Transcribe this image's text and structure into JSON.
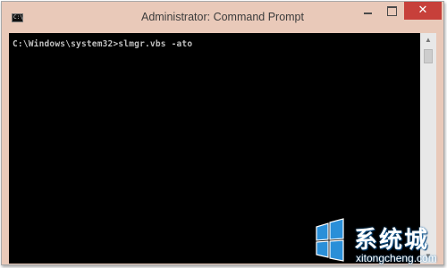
{
  "window": {
    "title": "Administrator: Command Prompt",
    "icon": "cmd-icon",
    "icon_glyph": "C:\\",
    "controls": {
      "minimize": "minimize-icon",
      "maximize": "maximize-icon",
      "close": "close-icon",
      "close_glyph": "✕"
    }
  },
  "console": {
    "lines": [
      "C:\\Windows\\system32>slmgr.vbs -ato"
    ]
  },
  "scrollbar": {
    "up_glyph": "▲",
    "down_glyph": "▼"
  },
  "watermark": {
    "brand": "系统城",
    "url": "xitongcheng.com"
  },
  "colors": {
    "console_bg": "#000000",
    "console_text": "#c0c0c0",
    "window_frame": "#e9c9b9",
    "close_button": "#c7403a",
    "watermark_blue": "#1a6fb0"
  }
}
